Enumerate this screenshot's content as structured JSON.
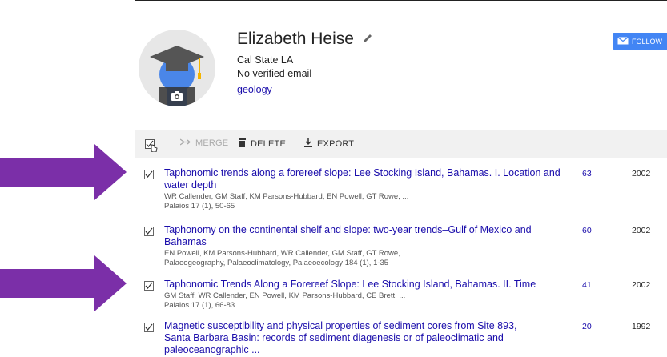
{
  "profile": {
    "name": "Elizabeth Heise",
    "affiliation": "Cal State LA",
    "email": "No verified email",
    "interest": "geology",
    "follow_label": "FOLLOW"
  },
  "toolbar": {
    "merge_label": "MERGE",
    "delete_label": "DELETE",
    "export_label": "EXPORT"
  },
  "articles": [
    {
      "title": "Taphonomic trends along a forereef slope: Lee Stocking Island, Bahamas. I. Location and water depth",
      "authors": "WR Callender, GM Staff, KM Parsons-Hubbard, EN Powell, GT Rowe, ...",
      "venue": "Palaios 17 (1), 50-65",
      "cited_by": "63",
      "year": "2002"
    },
    {
      "title": "Taphonomy on the continental shelf and slope: two-year trends–Gulf of Mexico and Bahamas",
      "authors": "EN Powell, KM Parsons-Hubbard, WR Callender, GM Staff, GT Rowe, ...",
      "venue": "Palaeogeography, Palaeoclimatology, Palaeoecology 184 (1), 1-35",
      "cited_by": "60",
      "year": "2002"
    },
    {
      "title": "Taphonomic Trends Along a Forereef Slope: Lee Stocking Island, Bahamas. II. Time",
      "authors": "GM Staff, WR Callender, EN Powell, KM Parsons-Hubbard, CE Brett, ...",
      "venue": "Palaios 17 (1), 66-83",
      "cited_by": "41",
      "year": "2002"
    },
    {
      "title": "Magnetic susceptibility and physical properties of sediment cores from Site 893, Santa Barbara Basin: records of sediment diagenesis or of paleoclimatic and paleoceanographic ...",
      "authors": "",
      "venue": "",
      "cited_by": "20",
      "year": "1992"
    }
  ],
  "colors": {
    "arrow": "#7b2fa8",
    "link": "#1a0dab",
    "follow_button": "#4285f4"
  }
}
